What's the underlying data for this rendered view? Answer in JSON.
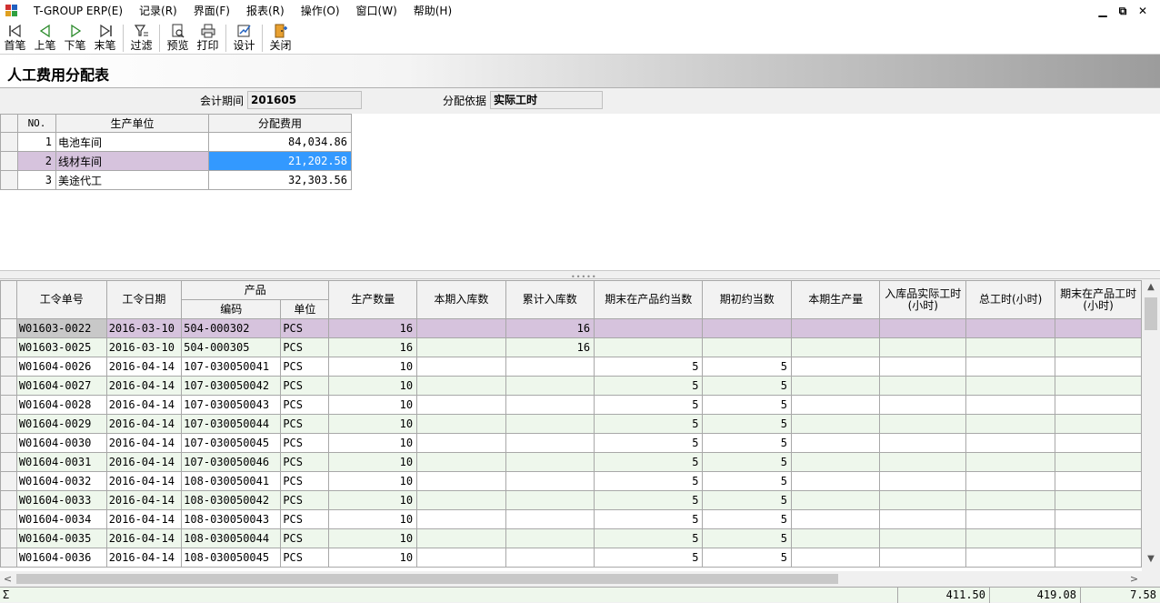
{
  "app": {
    "menu": [
      "T-GROUP ERP(E)",
      "记录(R)",
      "界面(F)",
      "报表(R)",
      "操作(O)",
      "窗口(W)",
      "帮助(H)"
    ],
    "window_controls": [
      "▁",
      "⧉",
      "✕"
    ]
  },
  "toolbar": [
    {
      "name": "first-record",
      "label": "首笔",
      "icon": "first-icon"
    },
    {
      "name": "prev-record",
      "label": "上笔",
      "icon": "prev-icon"
    },
    {
      "name": "next-record",
      "label": "下笔",
      "icon": "next-icon"
    },
    {
      "name": "last-record",
      "label": "末笔",
      "icon": "last-icon"
    },
    {
      "name": "filter",
      "label": "过滤",
      "icon": "filter-icon"
    },
    {
      "name": "preview",
      "label": "预览",
      "icon": "preview-icon"
    },
    {
      "name": "print",
      "label": "打印",
      "icon": "printer-icon"
    },
    {
      "name": "design",
      "label": "设计",
      "icon": "design-icon"
    },
    {
      "name": "close",
      "label": "关闭",
      "icon": "close-door-icon"
    }
  ],
  "page_title": "人工费用分配表",
  "form": {
    "period_label": "会计期间",
    "period_value": "201605",
    "basis_label": "分配依据",
    "basis_value": "实际工时"
  },
  "top_grid": {
    "headers": [
      "NO.",
      "生产单位",
      "分配费用"
    ],
    "rows": [
      {
        "no": "1",
        "unit": "电池车间",
        "fee": "84,034.86"
      },
      {
        "no": "2",
        "unit": "线材车间",
        "fee": "21,202.58"
      },
      {
        "no": "3",
        "unit": "美途代工",
        "fee": "32,303.56"
      }
    ],
    "selected_row": 1
  },
  "bottom_grid": {
    "headers": {
      "order_no": "工令单号",
      "order_date": "工令日期",
      "product": "产品",
      "code": "编码",
      "uom": "单位",
      "qty": "生产数量",
      "in_current": "本期入库数",
      "in_total": "累计入库数",
      "wip_end": "期末在产品约当数",
      "wip_begin": "期初约当数",
      "output": "本期生产量",
      "actual_hours": "入库品实际工时(小时)",
      "total_hours": "总工时(小时)",
      "wip_hours": "期末在产品工时(小时)"
    },
    "rows": [
      [
        "W01603-0022",
        "2016-03-10",
        "504-000302",
        "PCS",
        "16",
        "",
        "16",
        "",
        "",
        "",
        "",
        "",
        ""
      ],
      [
        "W01603-0025",
        "2016-03-10",
        "504-000305",
        "PCS",
        "16",
        "",
        "16",
        "",
        "",
        "",
        "",
        "",
        ""
      ],
      [
        "W01604-0026",
        "2016-04-14",
        "107-030050041",
        "PCS",
        "10",
        "",
        "",
        "5",
        "5",
        "",
        "",
        "",
        ""
      ],
      [
        "W01604-0027",
        "2016-04-14",
        "107-030050042",
        "PCS",
        "10",
        "",
        "",
        "5",
        "5",
        "",
        "",
        "",
        ""
      ],
      [
        "W01604-0028",
        "2016-04-14",
        "107-030050043",
        "PCS",
        "10",
        "",
        "",
        "5",
        "5",
        "",
        "",
        "",
        ""
      ],
      [
        "W01604-0029",
        "2016-04-14",
        "107-030050044",
        "PCS",
        "10",
        "",
        "",
        "5",
        "5",
        "",
        "",
        "",
        ""
      ],
      [
        "W01604-0030",
        "2016-04-14",
        "107-030050045",
        "PCS",
        "10",
        "",
        "",
        "5",
        "5",
        "",
        "",
        "",
        ""
      ],
      [
        "W01604-0031",
        "2016-04-14",
        "107-030050046",
        "PCS",
        "10",
        "",
        "",
        "5",
        "5",
        "",
        "",
        "",
        ""
      ],
      [
        "W01604-0032",
        "2016-04-14",
        "108-030050041",
        "PCS",
        "10",
        "",
        "",
        "5",
        "5",
        "",
        "",
        "",
        ""
      ],
      [
        "W01604-0033",
        "2016-04-14",
        "108-030050042",
        "PCS",
        "10",
        "",
        "",
        "5",
        "5",
        "",
        "",
        "",
        ""
      ],
      [
        "W01604-0034",
        "2016-04-14",
        "108-030050043",
        "PCS",
        "10",
        "",
        "",
        "5",
        "5",
        "",
        "",
        "",
        ""
      ],
      [
        "W01604-0035",
        "2016-04-14",
        "108-030050044",
        "PCS",
        "10",
        "",
        "",
        "5",
        "5",
        "",
        "",
        "",
        ""
      ],
      [
        "W01604-0036",
        "2016-04-14",
        "108-030050045",
        "PCS",
        "10",
        "",
        "",
        "5",
        "5",
        "",
        "",
        "",
        ""
      ]
    ],
    "selected_row": 0
  },
  "footer": {
    "sigma": "Σ",
    "totals": {
      "actual_hours": "411.50",
      "total_hours": "419.08",
      "wip_hours": "7.58"
    }
  },
  "colors": {
    "selected_row": "#d6c3dd",
    "selected_cell": "#3399ff",
    "alt_row": "#eef7ec"
  }
}
